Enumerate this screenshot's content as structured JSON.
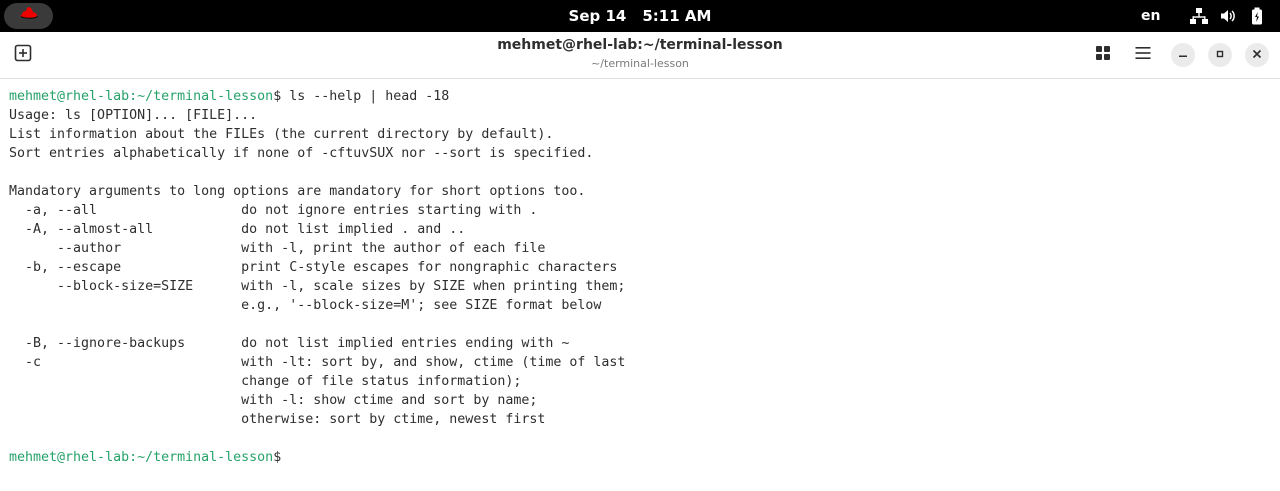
{
  "topbar": {
    "date": "Sep 14",
    "time": "5:11 AM",
    "language": "en",
    "icons": [
      "redhat-logo-icon",
      "network-icon",
      "volume-icon",
      "battery-icon"
    ]
  },
  "window": {
    "title": "mehmet@rhel-lab:~/terminal-lesson",
    "subtitle": "~/terminal-lesson",
    "icons": [
      "new-tab-icon",
      "tab-overview-icon",
      "menu-icon",
      "minimize-icon",
      "maximize-icon",
      "close-icon"
    ]
  },
  "terminal": {
    "prompt": "mehmet@rhel-lab:~/terminal-lesson",
    "command": "$ ls --help | head -18",
    "output": [
      "Usage: ls [OPTION]... [FILE]...",
      "List information about the FILEs (the current directory by default).",
      "Sort entries alphabetically if none of -cftuvSUX nor --sort is specified.",
      "",
      "Mandatory arguments to long options are mandatory for short options too.",
      "  -a, --all                  do not ignore entries starting with .",
      "  -A, --almost-all           do not list implied . and ..",
      "      --author               with -l, print the author of each file",
      "  -b, --escape               print C-style escapes for nongraphic characters",
      "      --block-size=SIZE      with -l, scale sizes by SIZE when printing them;",
      "                             e.g., '--block-size=M'; see SIZE format below",
      "",
      "  -B, --ignore-backups       do not list implied entries ending with ~",
      "  -c                         with -lt: sort by, and show, ctime (time of last",
      "                             change of file status information);",
      "                             with -l: show ctime and sort by name;",
      "                             otherwise: sort by ctime, newest first",
      ""
    ],
    "final_prompt": "mehmet@rhel-lab:~/terminal-lesson",
    "final_suffix": "$"
  }
}
